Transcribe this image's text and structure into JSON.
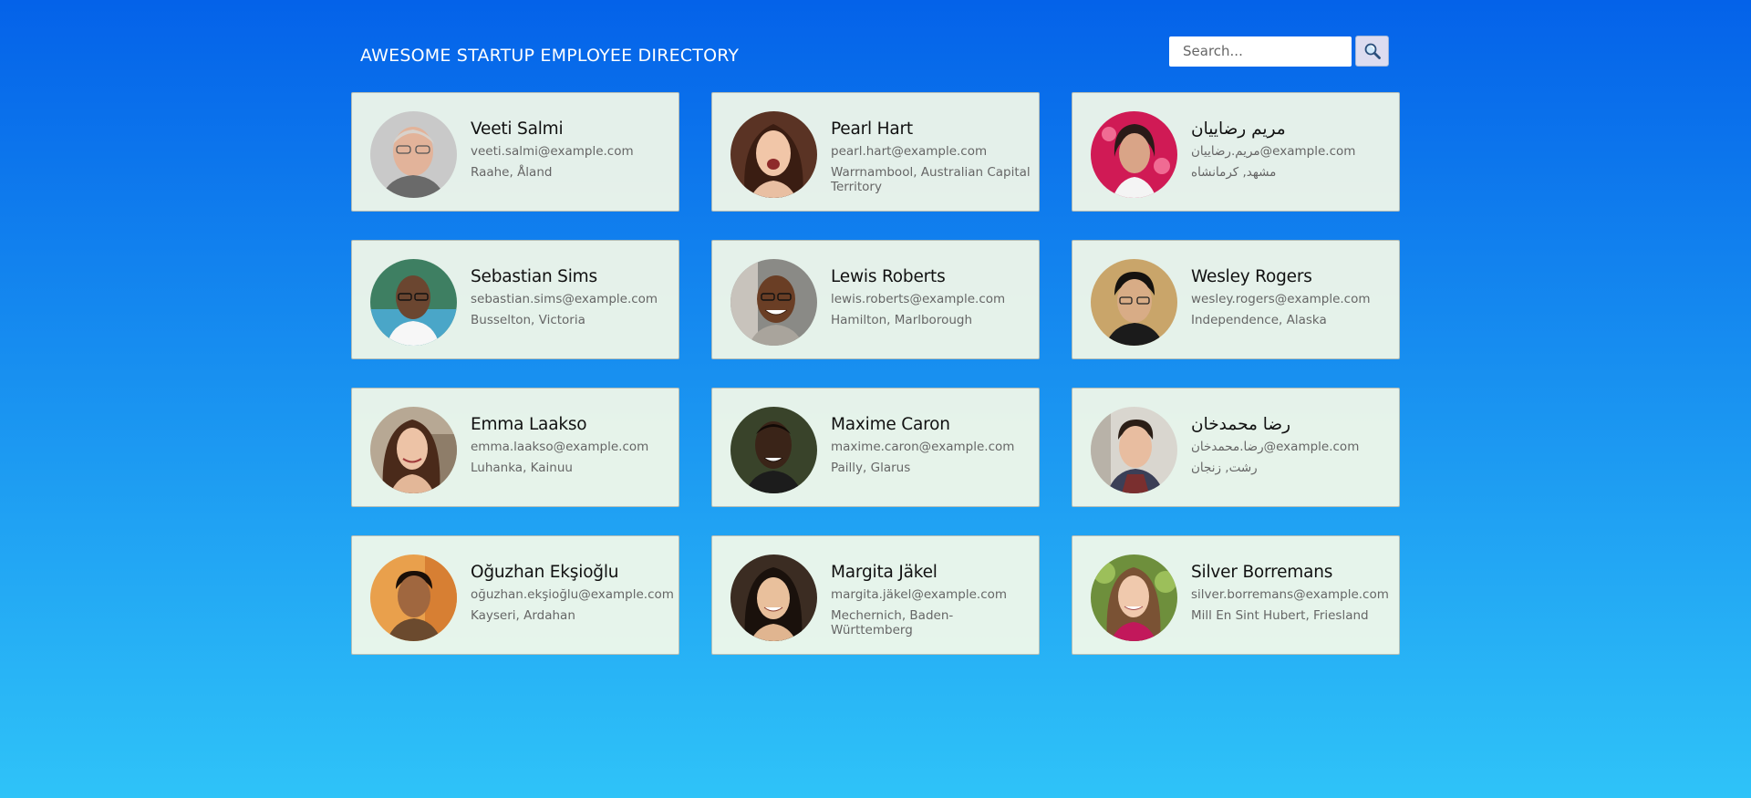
{
  "header": {
    "title": "AWESOME STARTUP EMPLOYEE DIRECTORY",
    "search_placeholder": "Search...",
    "search_button_icon": "magnifying-glass-icon"
  },
  "employees": [
    {
      "name": "Veeti Salmi",
      "email": "veeti.salmi@example.com",
      "location": "Raahe, Åland"
    },
    {
      "name": "Pearl Hart",
      "email": "pearl.hart@example.com",
      "location": "Warrnambool, Australian Capital Territory"
    },
    {
      "name": "مریم رضاییان",
      "email": "مریم.رضاییان@example.com",
      "location": "مشهد, کرمانشاه"
    },
    {
      "name": "Sebastian Sims",
      "email": "sebastian.sims@example.com",
      "location": "Busselton, Victoria"
    },
    {
      "name": "Lewis Roberts",
      "email": "lewis.roberts@example.com",
      "location": "Hamilton, Marlborough"
    },
    {
      "name": "Wesley Rogers",
      "email": "wesley.rogers@example.com",
      "location": "Independence, Alaska"
    },
    {
      "name": "Emma Laakso",
      "email": "emma.laakso@example.com",
      "location": "Luhanka, Kainuu"
    },
    {
      "name": "Maxime Caron",
      "email": "maxime.caron@example.com",
      "location": "Pailly, Glarus"
    },
    {
      "name": "رضا محمدخان",
      "email": "رضا.محمدخان@example.com",
      "location": "رشت, زنجان"
    },
    {
      "name": "Oğuzhan Ekşioğlu",
      "email": "oğuzhan.ekşioğlu@example.com",
      "location": "Kayseri, Ardahan"
    },
    {
      "name": "Margita Jäkel",
      "email": "margita.jäkel@example.com",
      "location": "Mechernich, Baden-Württemberg"
    },
    {
      "name": "Silver Borremans",
      "email": "silver.borremans@example.com",
      "location": "Mill En Sint Hubert, Friesland"
    }
  ],
  "colors": {
    "background_top": "#0462e9",
    "background_bottom": "#2fc3f8",
    "card_background": "#f5faea",
    "name_text": "#111111",
    "detail_text": "#666666"
  }
}
